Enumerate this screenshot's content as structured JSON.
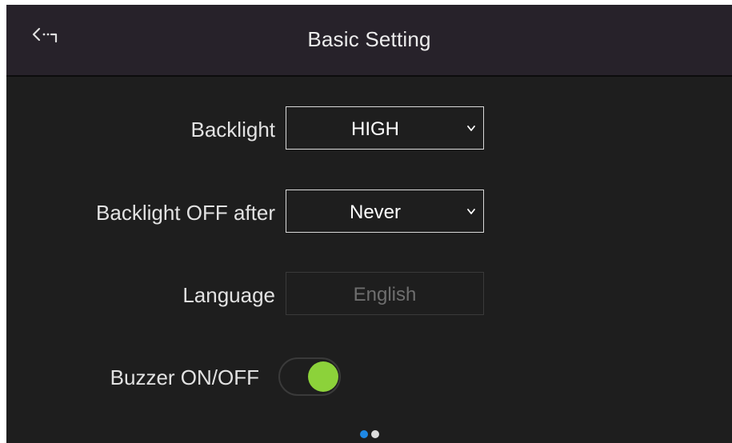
{
  "header": {
    "title": "Basic Setting",
    "back_icon": "back-arrow-icon"
  },
  "settings": {
    "backlight": {
      "label": "Backlight",
      "value": "HIGH"
    },
    "backlight_off": {
      "label": "Backlight OFF after",
      "value": "Never"
    },
    "language": {
      "label": "Language",
      "value": "English"
    },
    "buzzer": {
      "label": "Buzzer ON/OFF",
      "state": "on"
    }
  },
  "pagination": {
    "pages": 2,
    "current": 1
  },
  "colors": {
    "header_bg": "#27222a",
    "screen_bg": "#1e1e1e",
    "toggle_on": "#8cd23a",
    "dot_active": "#1e88e5",
    "dot_inactive": "#dddddd"
  }
}
